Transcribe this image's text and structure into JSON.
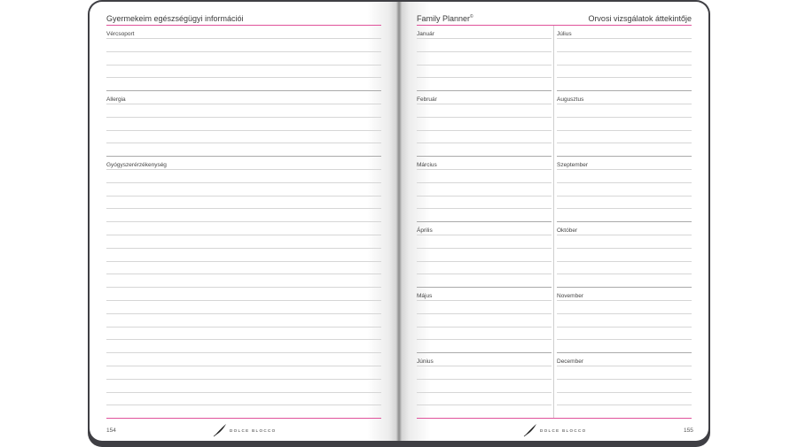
{
  "left_page": {
    "title": "Gyermekeim egészségügyi információi",
    "sections": [
      "Vércsoport",
      "Allergia",
      "Gyógyszerérzékenység"
    ],
    "page_number": "154",
    "brand": "DOLCE BLOCCO"
  },
  "right_page": {
    "title_left": "Family Planner",
    "title_left_mark": "©",
    "title_right": "Orvosi vizsgálatok áttekintője",
    "months_left": [
      "Január",
      "Február",
      "Március",
      "Április",
      "Május",
      "Június"
    ],
    "months_right": [
      "Július",
      "Augusztus",
      "Szeptember",
      "Október",
      "November",
      "December"
    ],
    "page_number": "155",
    "brand": "DOLCE BLOCCO"
  },
  "colors": {
    "accent": "#e0529b",
    "cover": "#3f3f44",
    "rule": "#d6d6d6"
  }
}
